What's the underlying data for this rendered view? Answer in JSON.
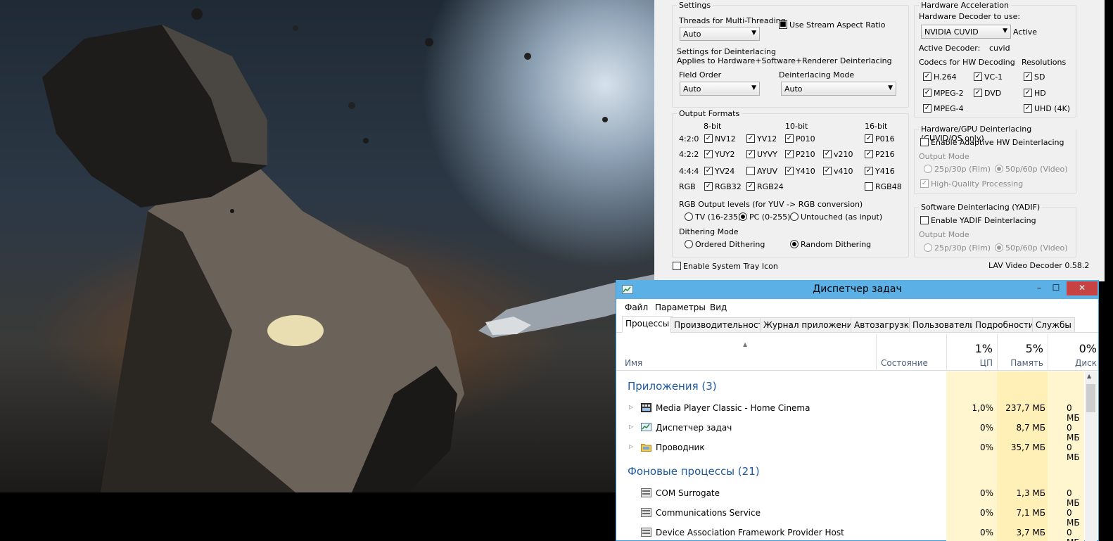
{
  "lav": {
    "settings": {
      "legend": "Settings",
      "threads_label": "Threads for Multi-Threading",
      "threads_value": "Auto",
      "aspect_label": "Use Stream Aspect Ratio",
      "deint_title": "Settings for Deinterlacing",
      "deint_sub": "Applies to Hardware+Software+Renderer Deinterlacing",
      "field_order_label": "Field Order",
      "field_order_value": "Auto",
      "deint_mode_label": "Deinterlacing Mode",
      "deint_mode_value": "Auto"
    },
    "output": {
      "legend": "Output Formats",
      "bit8": "8-bit",
      "bit10": "10-bit",
      "bit16": "16-bit",
      "row_420": "4:2:0",
      "row_422": "4:2:2",
      "row_444": "4:4:4",
      "row_rgb": "RGB",
      "fmt": {
        "nv12": "NV12",
        "yv12": "YV12",
        "p010": "P010",
        "p016": "P016",
        "yuy2": "YUY2",
        "uyvy": "UYVY",
        "p210": "P210",
        "v210": "v210",
        "p216": "P216",
        "yv24": "YV24",
        "ayuv": "AYUV",
        "y410": "Y410",
        "v410": "v410",
        "y416": "Y416",
        "rgb32": "RGB32",
        "rgb24": "RGB24",
        "rgb48": "RGB48"
      },
      "rgb_levels_label": "RGB Output levels (for YUV -> RGB conversion)",
      "tv": "TV (16-235)",
      "pc": "PC (0-255)",
      "untouched": "Untouched (as input)",
      "dither_label": "Dithering Mode",
      "ordered": "Ordered Dithering",
      "random": "Random Dithering"
    },
    "tray_label": "Enable System Tray Icon",
    "hw": {
      "legend": "Hardware Acceleration",
      "decoder_label": "Hardware Decoder to use:",
      "decoder_value": "NVIDIA CUVID",
      "decoder_status": "Active",
      "active_decoder_label": "Active Decoder:",
      "active_decoder_value": "cuvid",
      "codecs_label": "Codecs for HW Decoding",
      "resolutions_label": "Resolutions",
      "h264": "H.264",
      "vc1": "VC-1",
      "sd": "SD",
      "mpeg2": "MPEG-2",
      "dvd": "DVD",
      "hd": "HD",
      "mpeg4": "MPEG-4",
      "uhd": "UHD (4K)"
    },
    "hwdeint": {
      "legend": "Hardware/GPU Deinterlacing (CUVID/QS only)",
      "enable": "Enable Adaptive HW Deinterlacing",
      "output_mode": "Output Mode",
      "film": "25p/30p (Film)",
      "video": "50p/60p (Video)",
      "hq": "High-Quality Processing"
    },
    "swdeint": {
      "legend": "Software Deinterlacing (YADIF)",
      "enable": "Enable YADIF Deinterlacing",
      "output_mode": "Output Mode",
      "film": "25p/30p (Film)",
      "video": "50p/60p (Video)"
    },
    "version": "LAV Video Decoder 0.58.2"
  },
  "taskmgr": {
    "title": "Диспетчер задач",
    "minimize": "–",
    "maximize": "☐",
    "close": "✕",
    "menu": [
      "Файл",
      "Параметры",
      "Вид"
    ],
    "tabs": [
      "Процессы",
      "Производительность",
      "Журнал приложений",
      "Автозагрузка",
      "Пользователи",
      "Подробности",
      "Службы"
    ],
    "columns": {
      "name": "Имя",
      "state": "Состояние",
      "cpu_pct": "1%",
      "cpu": "ЦП",
      "mem_pct": "5%",
      "mem": "Память",
      "disk_pct": "0%",
      "disk": "Диск"
    },
    "apps_header": "Приложения (3)",
    "apps": [
      {
        "name": "Media Player Classic - Home Cinema",
        "cpu": "1,0%",
        "mem": "237,7 МБ",
        "disk": "0 МБ"
      },
      {
        "name": "Диспетчер задач",
        "cpu": "0%",
        "mem": "8,7 МБ",
        "disk": "0 МБ"
      },
      {
        "name": "Проводник",
        "cpu": "0%",
        "mem": "35,7 МБ",
        "disk": "0 МБ"
      }
    ],
    "bg_header": "Фоновые процессы (21)",
    "bg": [
      {
        "name": "COM Surrogate",
        "cpu": "0%",
        "mem": "1,3 МБ",
        "disk": "0 МБ"
      },
      {
        "name": "Communications Service",
        "cpu": "0%",
        "mem": "7,1 МБ",
        "disk": "0 МБ"
      },
      {
        "name": "Device Association Framework Provider Host",
        "cpu": "0%",
        "mem": "3,7 МБ",
        "disk": "0 МБ"
      }
    ]
  }
}
